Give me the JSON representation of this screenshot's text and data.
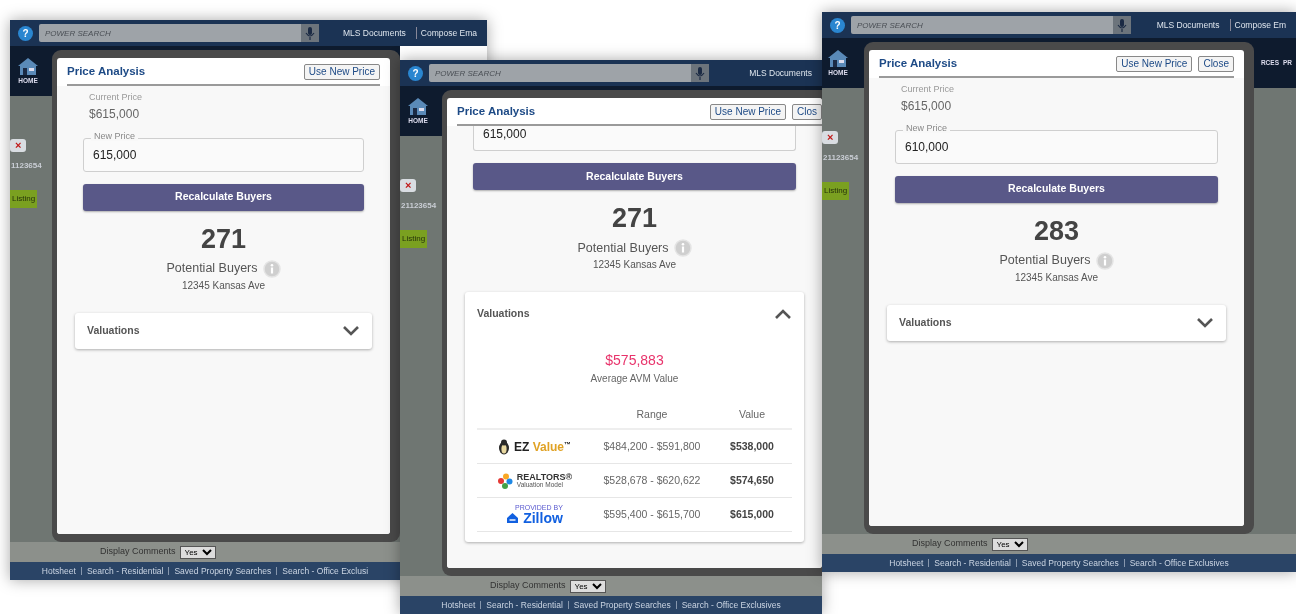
{
  "shots": [
    {
      "header": {
        "help_glyph": "?",
        "search_placeholder": "POWER SEARCH",
        "links": [
          "MLS Documents",
          "Compose Ema"
        ]
      },
      "nav": [
        "HOME"
      ],
      "background": {
        "close_glyph": "×",
        "record_id": "1123654",
        "status": "Listing"
      },
      "modal": {
        "title": "Price Analysis",
        "buttons": [
          "Use New Price"
        ],
        "current_price": {
          "label": "Current Price",
          "value": "$615,000"
        },
        "new_price": {
          "label": "New Price",
          "value": "615,000"
        },
        "recalc_button": "Recalculate Buyers",
        "buyer_count": "271",
        "buyers_label": "Potential Buyers",
        "address": "12345 Kansas Ave",
        "valuations": {
          "title": "Valuations",
          "expanded": false
        }
      },
      "display_comments": {
        "label": "Display Comments",
        "value": "Yes"
      },
      "footer": [
        "Hotsheet",
        "Search - Residential",
        "Saved Property Searches",
        "Search - Office Exclusi"
      ]
    },
    {
      "header": {
        "help_glyph": "?",
        "search_placeholder": "POWER SEARCH",
        "links": [
          "MLS Documents"
        ]
      },
      "nav": [
        "HOME"
      ],
      "background": {
        "close_glyph": "×",
        "record_id": "21123654",
        "status": "Listing"
      },
      "modal": {
        "title": "Price Analysis",
        "buttons": [
          "Use New Price",
          "Clos"
        ],
        "new_price": {
          "value": "615,000"
        },
        "recalc_button": "Recalculate Buyers",
        "buyer_count": "271",
        "buyers_label": "Potential Buyers",
        "address": "12345 Kansas Ave",
        "valuations": {
          "title": "Valuations",
          "expanded": true,
          "average": "$575,883",
          "average_label": "Average AVM Value",
          "columns": [
            "Range",
            "Value"
          ],
          "rows": [
            {
              "provider": {
                "kind": "ez",
                "brand": "EZ",
                "accent": "Value",
                "mark": "™"
              },
              "range": "$484,200 - $591,800",
              "value": "$538,000"
            },
            {
              "provider": {
                "kind": "realtors",
                "brand": "REALTORS®",
                "subtitle": "Valuation Model"
              },
              "range": "$528,678 - $620,622",
              "value": "$574,650"
            },
            {
              "provider": {
                "kind": "zillow",
                "tagline": "PROVIDED BY",
                "brand": "Zillow"
              },
              "range": "$595,400 - $615,700",
              "value": "$615,000"
            }
          ]
        }
      },
      "display_comments": {
        "label": "Display Comments",
        "value": "Yes"
      },
      "footer": [
        "Hotsheet",
        "Search - Residential",
        "Saved Property Searches",
        "Search - Office Exclusives"
      ]
    },
    {
      "header": {
        "help_glyph": "?",
        "search_placeholder": "POWER SEARCH",
        "links": [
          "MLS Documents",
          "Compose Em"
        ]
      },
      "nav": [
        "HOME",
        "RCES",
        "PR"
      ],
      "background": {
        "close_glyph": "×",
        "record_id": "21123654",
        "status": "Listing"
      },
      "modal": {
        "title": "Price Analysis",
        "buttons": [
          "Use New Price",
          "Close"
        ],
        "current_price": {
          "label": "Current Price",
          "value": "$615,000"
        },
        "new_price": {
          "label": "New Price",
          "value": "610,000"
        },
        "recalc_button": "Recalculate Buyers",
        "buyer_count": "283",
        "buyers_label": "Potential Buyers",
        "address": "12345 Kansas Ave",
        "valuations": {
          "title": "Valuations",
          "expanded": false
        }
      },
      "display_comments": {
        "label": "Display Comments",
        "value": "Yes"
      },
      "footer": [
        "Hotsheet",
        "Search - Residential",
        "Saved Property Searches",
        "Search - Office Exclusives"
      ]
    }
  ]
}
